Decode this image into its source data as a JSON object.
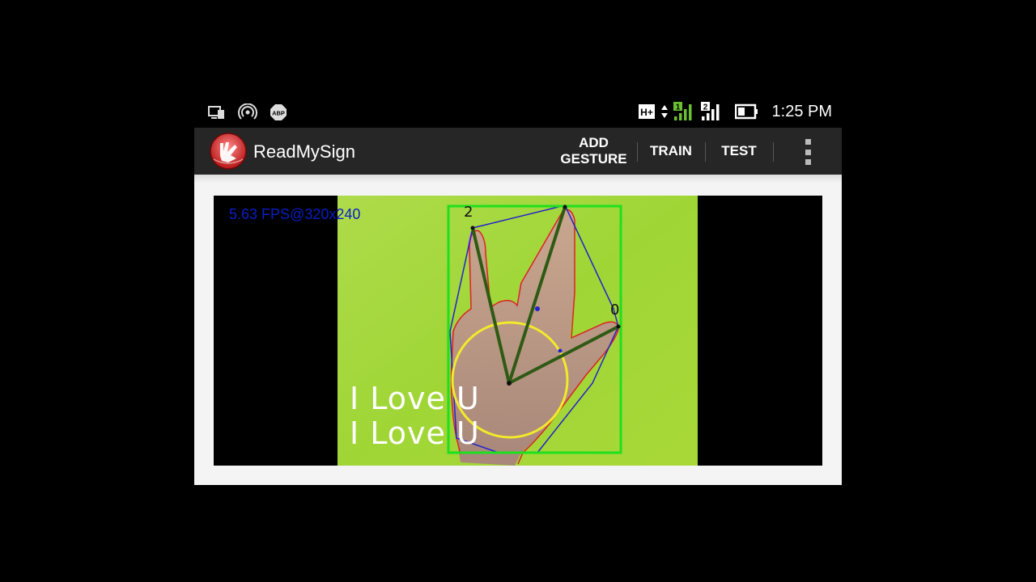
{
  "status_bar": {
    "left_icons": [
      "screen-mirror-icon",
      "hotspot-icon",
      "adblock-icon"
    ],
    "adblock_label": "ABP",
    "network_type": "H+",
    "sim1_label": "1",
    "sim2_label": "2",
    "right_icons": [
      "network-type-icon",
      "signal-sim1-icon",
      "signal-sim2-icon",
      "battery-icon"
    ],
    "time": "1:25 PM"
  },
  "action_bar": {
    "app_icon": "sign-hand-logo-icon",
    "title": "ReadMySign",
    "actions": [
      {
        "line1": "ADD",
        "line2": "GESTURE"
      },
      {
        "label": "TRAIN"
      },
      {
        "label": "TEST"
      }
    ],
    "overflow_icon": "overflow-menu-icon"
  },
  "camera": {
    "fps_text": "5.63 FPS@320x240",
    "contour_label": "2",
    "contour_label_2": "0",
    "results": [
      "I Love U",
      "I Love U"
    ],
    "colors": {
      "background_green": "#9fd636",
      "bounding_box": "#1ee01e",
      "palm_circle": "#f2ea2a",
      "hull": "#2222cc",
      "contour": "#d22",
      "finger_lines": "#2e5a14",
      "fps_text": "#0a1ec8"
    }
  }
}
